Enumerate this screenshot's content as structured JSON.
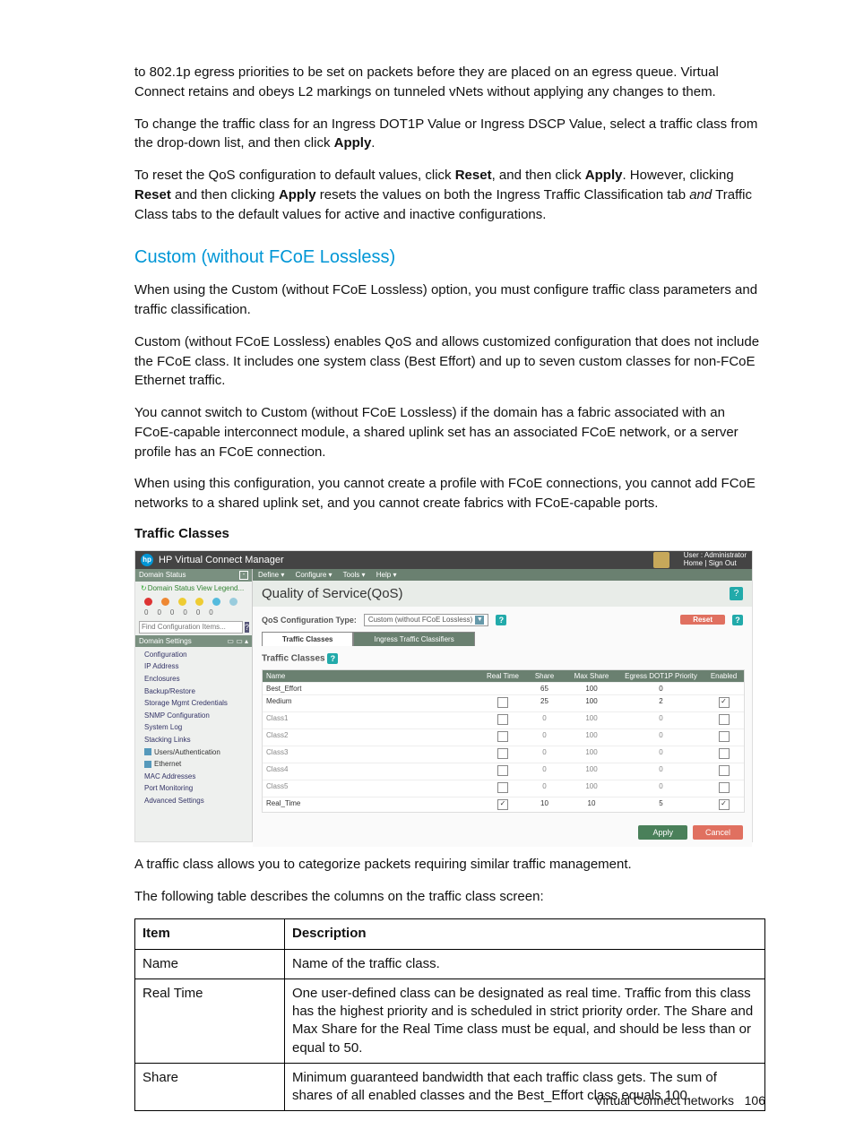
{
  "paragraphs": {
    "p1a": "to 802.1p egress priorities to be set on packets before they are placed on an egress queue. Virtual Connect retains and obeys L2 markings on tunneled vNets without applying any changes to them.",
    "p2a": "To change the traffic class for an Ingress DOT1P Value or Ingress DSCP Value, select a traffic class from the drop-down list, and then click ",
    "p2b": "Apply",
    "p2c": ".",
    "p3a": "To reset the QoS configuration to default values, click ",
    "p3b": "Reset",
    "p3c": ", and then click ",
    "p3d": "Apply",
    "p3e": ". However, clicking ",
    "p3f": "Reset",
    "p3g": " and then clicking ",
    "p3h": "Apply",
    "p3i": " resets the values on both the Ingress Traffic Classification tab ",
    "p3j": "and",
    "p3k": " Traffic Class tabs to the default values for active and inactive configurations.",
    "p4": "When using the Custom (without FCoE Lossless) option, you must configure traffic class parameters and traffic classification.",
    "p5": "Custom (without FCoE Lossless) enables QoS and allows customized configuration that does not include the FCoE class. It includes one system class (Best Effort) and up to seven custom classes for non-FCoE Ethernet traffic.",
    "p6": "You cannot switch to Custom (without FCoE Lossless) if the domain has a fabric associated with an FCoE-capable interconnect module, a shared uplink set has an associated FCoE network, or a server profile has an FCoE connection.",
    "p7": "When using this configuration, you cannot create a profile with FCoE connections, you cannot add FCoE networks to a shared uplink set, and you cannot create fabrics with FCoE-capable ports.",
    "p8": "A traffic class allows you to categorize packets requiring similar traffic management.",
    "p9": "The following table describes the columns on the traffic class screen:"
  },
  "heading": "Custom (without FCoE Lossless)",
  "subhead": "Traffic Classes",
  "screenshot": {
    "app_title": "HP Virtual Connect Manager",
    "user_line1": "User : Administrator",
    "user_line2": "Home  |  Sign Out",
    "domain_status": "Domain Status",
    "status_row": "Domain Status   View Legend...",
    "counts": [
      "0",
      "0",
      "0",
      "0",
      "0",
      "0"
    ],
    "find_placeholder": "Find Configuration Items...",
    "domain_settings": "Domain Settings",
    "nav": [
      "Configuration",
      "IP Address",
      "Enclosures",
      "Backup/Restore",
      "Storage Mgmt Credentials",
      "SNMP Configuration",
      "System Log",
      "Stacking Links"
    ],
    "nav_grp1": "Users/Authentication",
    "nav_grp2": "Ethernet",
    "nav2": [
      "MAC Addresses",
      "Port Monitoring",
      "Advanced Settings"
    ],
    "menu": [
      "Define ▾",
      "Configure ▾",
      "Tools ▾",
      "Help ▾"
    ],
    "page_title": "Quality of Service(QoS)",
    "cfg_label": "QoS Configuration Type:",
    "cfg_value": "Custom (without FCoE Lossless)",
    "reset": "Reset",
    "tab1": "Traffic Classes",
    "tab2": "Ingress Traffic Classifiers",
    "tc_label": "Traffic Classes",
    "cols": {
      "name": "Name",
      "rt": "Real Time",
      "sh": "Share",
      "ms": "Max Share",
      "eg": "Egress DOT1P Priority",
      "en": "Enabled"
    },
    "rows": [
      {
        "name": "Best_Effort",
        "rt": "",
        "sh": "65",
        "ms": "100",
        "eg": "0",
        "en": "",
        "dark": true
      },
      {
        "name": "Medium",
        "rt": "☐",
        "sh": "25",
        "ms": "100",
        "eg": "2",
        "en": "☑",
        "dark": true
      },
      {
        "name": "Class1",
        "rt": "☐",
        "sh": "0",
        "ms": "100",
        "eg": "0",
        "en": "☐",
        "dark": false
      },
      {
        "name": "Class2",
        "rt": "☐",
        "sh": "0",
        "ms": "100",
        "eg": "0",
        "en": "☐",
        "dark": false
      },
      {
        "name": "Class3",
        "rt": "☐",
        "sh": "0",
        "ms": "100",
        "eg": "0",
        "en": "☐",
        "dark": false
      },
      {
        "name": "Class4",
        "rt": "☐",
        "sh": "0",
        "ms": "100",
        "eg": "0",
        "en": "☐",
        "dark": false
      },
      {
        "name": "Class5",
        "rt": "☐",
        "sh": "0",
        "ms": "100",
        "eg": "0",
        "en": "☐",
        "dark": false
      },
      {
        "name": "Real_Time",
        "rt": "☑",
        "sh": "10",
        "ms": "10",
        "eg": "5",
        "en": "☑",
        "dark": true
      }
    ],
    "apply": "Apply",
    "cancel": "Cancel"
  },
  "table": {
    "h1": "Item",
    "h2": "Description",
    "r1c1": "Name",
    "r1c2": "Name of the traffic class.",
    "r2c1": "Real Time",
    "r2c2": "One user-defined class can be designated as real time. Traffic from this class has the highest priority and is scheduled in strict priority order. The Share and Max Share for the Real Time class must be equal, and should be less than or equal to 50.",
    "r3c1": "Share",
    "r3c2": "Minimum guaranteed bandwidth that each traffic class gets. The sum of shares of all enabled classes and the Best_Effort class equals 100."
  },
  "footer": {
    "text": "Virtual Connect networks",
    "page": "106"
  }
}
